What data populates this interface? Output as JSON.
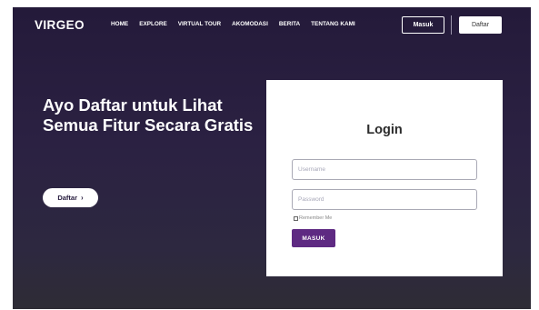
{
  "brand": {
    "logo": "VIRGEO"
  },
  "nav": {
    "items": [
      "HOME",
      "EXPLORE",
      "VIRTUAL TOUR",
      "AKOMODASI",
      "BERITA",
      "TENTANG KAMI"
    ],
    "masuk_label": "Masuk",
    "daftar_label": "Daftar"
  },
  "hero": {
    "title": "Ayo Daftar untuk Lihat Semua Fitur Secara Gratis",
    "cta_label": "Daftar",
    "cta_icon": "chevron-right-icon"
  },
  "login": {
    "title": "Login",
    "username": {
      "placeholder": "Username",
      "value": ""
    },
    "password": {
      "placeholder": "Password",
      "value": ""
    },
    "remember_label": "Remember Me",
    "remember_checked": false,
    "submit_label": "MASUK"
  },
  "colors": {
    "background_top": "#241a3a",
    "background_bottom": "#2e2c35",
    "accent": "#5e2a82",
    "card": "#ffffff"
  }
}
